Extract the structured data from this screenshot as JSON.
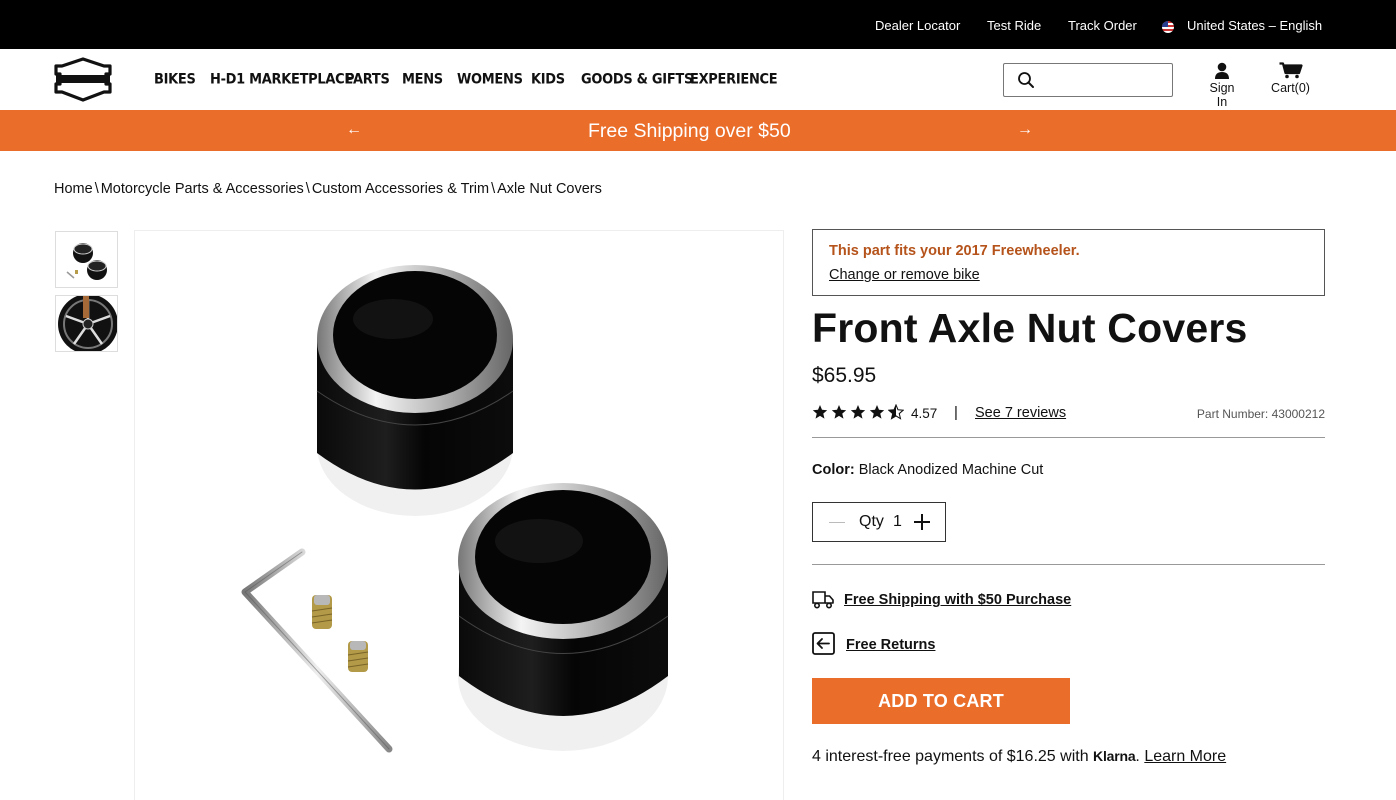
{
  "utility_bar": {
    "dealer_locator": "Dealer Locator",
    "test_ride": "Test Ride",
    "track_order": "Track Order",
    "locale": "United States – English"
  },
  "header": {
    "nav": [
      "BIKES",
      "H-D1 MARKETPLACE",
      "PARTS",
      "MENS",
      "WOMENS",
      "KIDS",
      "GOODS & GIFTS",
      "EXPERIENCE"
    ],
    "search": {
      "value": "",
      "placeholder": ""
    },
    "sign_in": "Sign In",
    "cart": "Cart(0)"
  },
  "promo": {
    "text": "Free Shipping over $50",
    "prev_arrow": "←",
    "next_arrow": "→"
  },
  "breadcrumb": {
    "items": [
      "Home",
      "Motorcycle Parts & Accessories",
      "Custom Accessories & Trim",
      "Axle Nut Covers"
    ],
    "separator": "\\"
  },
  "fitment": {
    "message": "This part fits your 2017 Freewheeler.",
    "change_link": "Change or remove bike"
  },
  "product": {
    "title": "Front Axle Nut Covers",
    "price": "$65.95",
    "rating": 4.57,
    "rating_text": "4.57",
    "rating_separator": "|",
    "reviews_link": "See 7 reviews",
    "part_number": "Part Number: 43000212",
    "color_label": "Color:",
    "color_value": "Black Anodized Machine Cut",
    "qty_label": "Qty",
    "qty_value": "1",
    "free_shipping": "Free Shipping with $50 Purchase",
    "free_returns": "Free Returns",
    "add_to_cart": "ADD TO CART",
    "klarna_prefix": "4 interest-free payments of $16.25 with",
    "klarna_brand": "Klarna",
    "klarna_link": "Learn More"
  },
  "colors": {
    "accent_orange": "#ea6d2a",
    "fitment_text": "#b5531b",
    "utility_bg": "#000000"
  },
  "icons": [
    "harley-logo-icon",
    "search-icon",
    "user-icon",
    "cart-icon",
    "truck-icon",
    "return-icon",
    "star-icon",
    "us-flag-icon"
  ]
}
